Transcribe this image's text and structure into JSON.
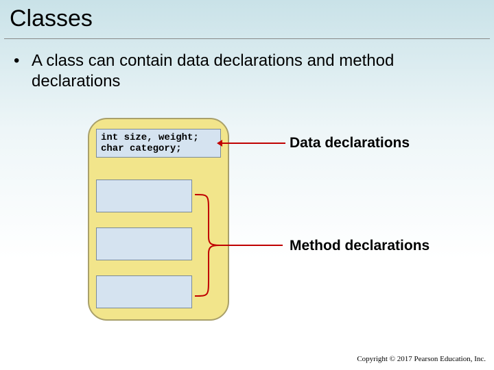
{
  "title": "Classes",
  "bullet": "A class can contain data declarations and method declarations",
  "code_line1": "int size, weight;",
  "code_line2": "char category;",
  "labels": {
    "data": "Data declarations",
    "method": "Method declarations"
  },
  "copyright": "Copyright © 2017 Pearson Education, Inc.",
  "colors": {
    "accent_red": "#c00000",
    "box_fill": "#d5e3f0",
    "container_fill": "#f2e58b"
  }
}
